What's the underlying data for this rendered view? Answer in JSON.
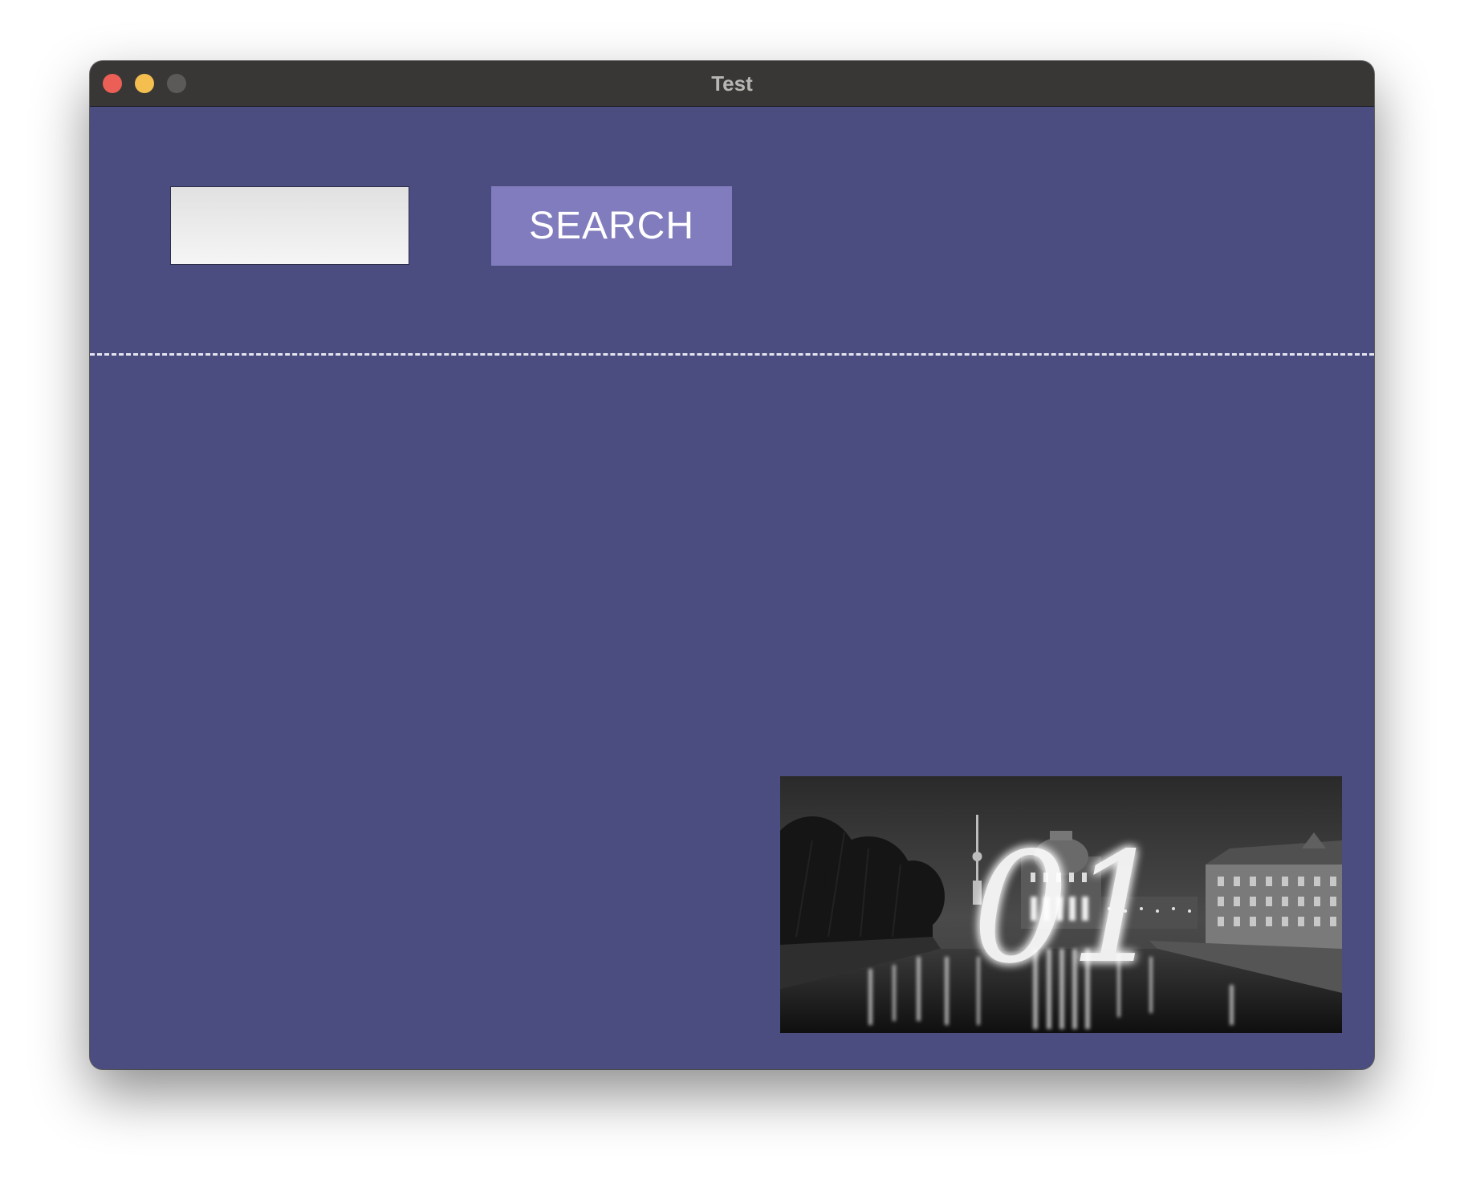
{
  "window": {
    "title": "Test"
  },
  "search": {
    "value": "",
    "placeholder": "",
    "button_label": "SEARCH"
  },
  "image": {
    "overlay_text": "01",
    "description_icon": "night-city-photo"
  },
  "colors": {
    "background": "#4b4c80",
    "button": "#817cbd",
    "titlebar": "#383735",
    "close": "#ec5f57",
    "minimize": "#f4bf4f",
    "zoom": "#5b5a59"
  }
}
